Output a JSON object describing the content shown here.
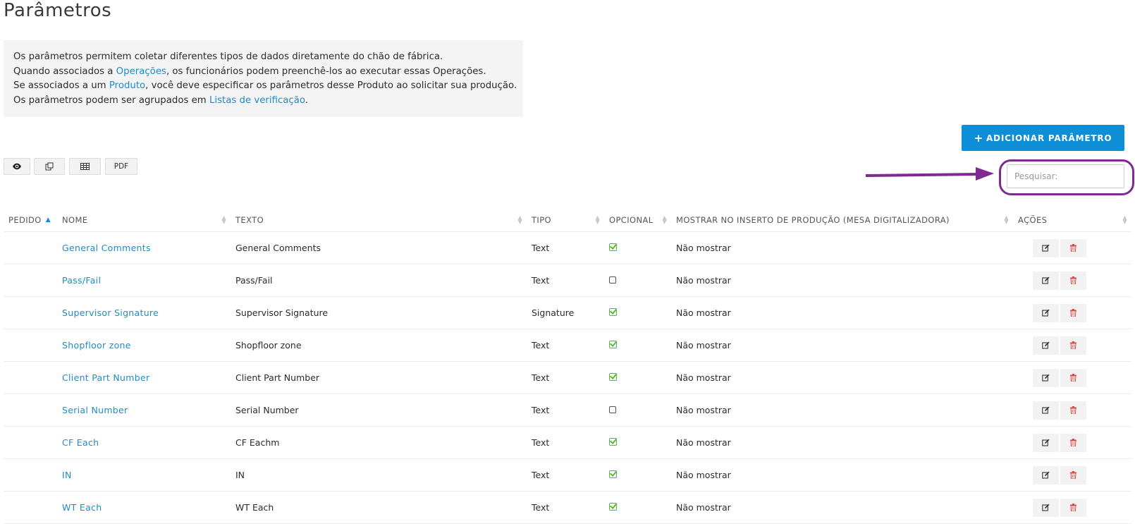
{
  "page": {
    "title": "Parâmetros"
  },
  "info": {
    "line1": "Os parâmetros permitem coletar diferentes tipos de dados diretamente do chão de fábrica.",
    "line2_pre": "Quando associados a ",
    "line2_link": "Operações",
    "line2_post": ", os funcionários podem preenchê-los ao executar essas Operações.",
    "line3_pre": "Se associados a um ",
    "line3_link": "Produto",
    "line3_post": ", você deve especificar os parâmetros desse Produto ao solicitar sua produção.",
    "line4_pre": "Os parâmetros podem ser agrupados em ",
    "line4_link": "Listas de verificação",
    "line4_post": "."
  },
  "toolbar": {
    "add_label": "ADICIONAR PARÂMETRO",
    "add_icon": "plus-icon",
    "pdf_label": "PDF",
    "icons": [
      "eye-icon",
      "copy-icon",
      "table-icon"
    ]
  },
  "search": {
    "placeholder": "Pesquisar:",
    "value": ""
  },
  "annotation": {
    "color": "#7e2a91"
  },
  "table": {
    "headers": {
      "order": "PEDIDO",
      "name": "NOME",
      "text": "TEXTO",
      "type": "TIPO",
      "optional": "OPCIONAL",
      "show": "MOSTRAR NO INSERTO DE PRODUÇÃO (MESA DIGITALIZADORA)",
      "actions": "AÇÕES"
    },
    "rows": [
      {
        "order": "",
        "name": "General Comments",
        "text": "General Comments",
        "type": "Text",
        "optional": true,
        "show": "Não mostrar"
      },
      {
        "order": "",
        "name": "Pass/Fail",
        "text": "Pass/Fail",
        "type": "Text",
        "optional": false,
        "show": "Não mostrar"
      },
      {
        "order": "",
        "name": "Supervisor Signature",
        "text": "Supervisor Signature",
        "type": "Signature",
        "optional": true,
        "show": "Não mostrar"
      },
      {
        "order": "",
        "name": "Shopfloor zone",
        "text": "Shopfloor zone",
        "type": "Text",
        "optional": true,
        "show": "Não mostrar"
      },
      {
        "order": "",
        "name": "Client Part Number",
        "text": "Client Part Number",
        "type": "Text",
        "optional": true,
        "show": "Não mostrar"
      },
      {
        "order": "",
        "name": "Serial Number",
        "text": "Serial Number",
        "type": "Text",
        "optional": false,
        "show": "Não mostrar"
      },
      {
        "order": "",
        "name": "CF Each",
        "text": "CF Eachm",
        "type": "Text",
        "optional": true,
        "show": "Não mostrar"
      },
      {
        "order": "",
        "name": "IN",
        "text": "IN",
        "type": "Text",
        "optional": true,
        "show": "Não mostrar"
      },
      {
        "order": "",
        "name": "WT Each",
        "text": "WT Each",
        "type": "Text",
        "optional": true,
        "show": "Não mostrar"
      }
    ]
  },
  "colors": {
    "accent": "#0d8ed6",
    "link": "#1f8bc9",
    "check": "#5fb33f",
    "delete": "#e0443f"
  }
}
